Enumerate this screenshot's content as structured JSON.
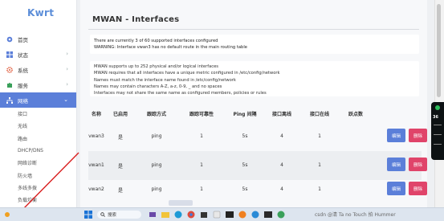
{
  "app": {
    "logo": "Kwrt",
    "page_title": "MWAN - Interfaces"
  },
  "sidebar": {
    "items": [
      {
        "label": "首页",
        "icon": "dashboard-icon",
        "color": "#5b7fd9"
      },
      {
        "label": "状态",
        "icon": "grid-icon",
        "color": "#5b7fd9"
      },
      {
        "label": "系统",
        "icon": "gear-icon",
        "color": "#e05a3a"
      },
      {
        "label": "服务",
        "icon": "puzzle-icon",
        "color": "#3aa05a"
      },
      {
        "label": "网络",
        "icon": "network-icon",
        "color": "#ffffff"
      }
    ],
    "sub_items": [
      "接口",
      "无线",
      "路由",
      "DHCP/DNS",
      "网络诊断",
      "防火墙",
      "多线多拨",
      "负载均衡"
    ]
  },
  "notices": {
    "line1": "There are currently 3 of 60 supported interfaces configured",
    "line2": "WARNING: Interface vwan3 has no default route in the main routing table"
  },
  "info": [
    "MWAN supports up to 252 physical and/or logical interfaces",
    "MWAN requires that all interfaces have a unique metric configured in /etc/config/network",
    "Names must match the interface name found in /etc/config/network",
    "Names may contain characters A-Z, a-z, 0-9, _ and no spaces",
    "Interfaces may not share the same name as configured members, policies or rules"
  ],
  "table": {
    "headers": [
      "名称",
      "已启用",
      "跟踪方式",
      "跟踪可靠性",
      "Ping 间隔",
      "接口离线",
      "接口在线",
      "跃点数"
    ],
    "rows": [
      {
        "name": "vwan3",
        "enabled": "是",
        "method": "ping",
        "reliability": "1",
        "interval": "5s",
        "down": "4",
        "up": "1",
        "metric": ""
      },
      {
        "name": "vwan1",
        "enabled": "是",
        "method": "ping",
        "reliability": "1",
        "interval": "5s",
        "down": "4",
        "up": "1",
        "metric": ""
      },
      {
        "name": "vwan2",
        "enabled": "是",
        "method": "ping",
        "reliability": "1",
        "interval": "5s",
        "down": "4",
        "up": "1",
        "metric": ""
      }
    ],
    "edit_label": "编辑",
    "delete_label": "删除"
  },
  "tray": {
    "widget_value": "36"
  },
  "taskbar": {
    "search_placeholder": "搜索",
    "watermark": "csdn @清 Ta no Touch 拍 Hummer"
  },
  "colors": {
    "accent": "#5b7fd9",
    "danger": "#e0446a"
  }
}
